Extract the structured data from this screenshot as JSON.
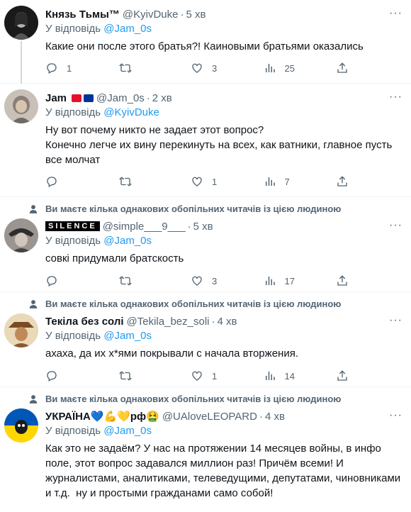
{
  "tweets": [
    {
      "name": "Князь Тьмы™",
      "handle": "@KyivDuke",
      "time": "5 хв",
      "replying_prefix": "У відповідь",
      "replying_to": "@Jam_0s",
      "text": "Какие они после этого братья?! Каиновыми братьями оказались",
      "counts": {
        "reply": "1",
        "retweet": "",
        "like": "3",
        "views": "25"
      }
    },
    {
      "name": "Jam",
      "handle": "@Jam_0s",
      "time": "2 хв",
      "replying_prefix": "У відповідь",
      "replying_to": "@KyivDuke",
      "text": "Ну вот почему никто не задает этот вопрос?\nКонечно легче их вину перекинуть на всех, как ватники, главное пусть все молчат",
      "counts": {
        "reply": "",
        "retweet": "",
        "like": "1",
        "views": "7"
      }
    },
    {
      "social": "Ви маєте кілька однакових обопільних читачів із цією людиною",
      "name": "SILENCE",
      "handle": "@simple___9___",
      "time": "5 хв",
      "replying_prefix": "У відповідь",
      "replying_to": "@Jam_0s",
      "text": "совкі придумали братскость",
      "counts": {
        "reply": "",
        "retweet": "",
        "like": "3",
        "views": "17"
      }
    },
    {
      "social": "Ви маєте кілька однакових обопільних читачів із цією людиною",
      "name": "Текіла без солі",
      "handle": "@Tekila_bez_soli",
      "time": "4 хв",
      "replying_prefix": "У відповідь",
      "replying_to": "@Jam_0s",
      "text": "ахаха, да их х*ями покрывали с начала вторжения.",
      "counts": {
        "reply": "",
        "retweet": "",
        "like": "1",
        "views": "14"
      }
    },
    {
      "social": "Ви маєте кілька однакових обопільних читачів із цією людиною",
      "name": "УКРАЇНА💙💪💛рф🤮",
      "handle": "@UAloveLEOPARD",
      "time": "4 хв",
      "replying_prefix": "У відповідь",
      "replying_to": "@Jam_0s",
      "text": "Как это не задаём? У нас на протяжении 14 месяцев войны, в инфо поле, этот вопрос задавался миллион раз! Причём всеми! И журналистами, аналитиками, телеведущими, депутатами, чиновниками и т.д.  ну и простыми гражданами само собой!"
    }
  ],
  "colors": {
    "text": "#0f1419",
    "secondary": "#536471",
    "link": "#1d9bf0",
    "divider": "#eff3f4"
  }
}
